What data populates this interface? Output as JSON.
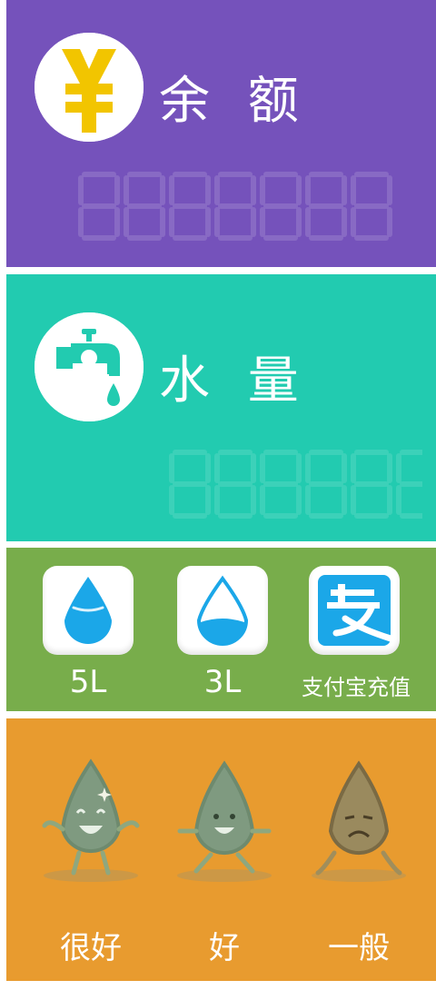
{
  "balance": {
    "title": "余 额",
    "icon": "yen-icon",
    "digits_placeholder": "8888888",
    "panel_color": "#7552bb",
    "icon_color": "#f2c500"
  },
  "water": {
    "title": "水 量",
    "icon": "faucet-icon",
    "digits_placeholder": "888888",
    "panel_color": "#22cbb0"
  },
  "purchase": {
    "panel_color": "#78ad4b",
    "options": [
      {
        "label": "5L",
        "icon": "water-drop-full-icon"
      },
      {
        "label": "3L",
        "icon": "water-drop-half-icon"
      },
      {
        "label": "支付宝充值",
        "icon": "alipay-icon"
      }
    ],
    "accent": "#1ba7e8"
  },
  "rating": {
    "panel_color": "#e89b2f",
    "options": [
      {
        "label": "很好",
        "icon": "happy-drop-icon"
      },
      {
        "label": "好",
        "icon": "smile-drop-icon"
      },
      {
        "label": "一般",
        "icon": "sad-drop-icon"
      }
    ]
  }
}
